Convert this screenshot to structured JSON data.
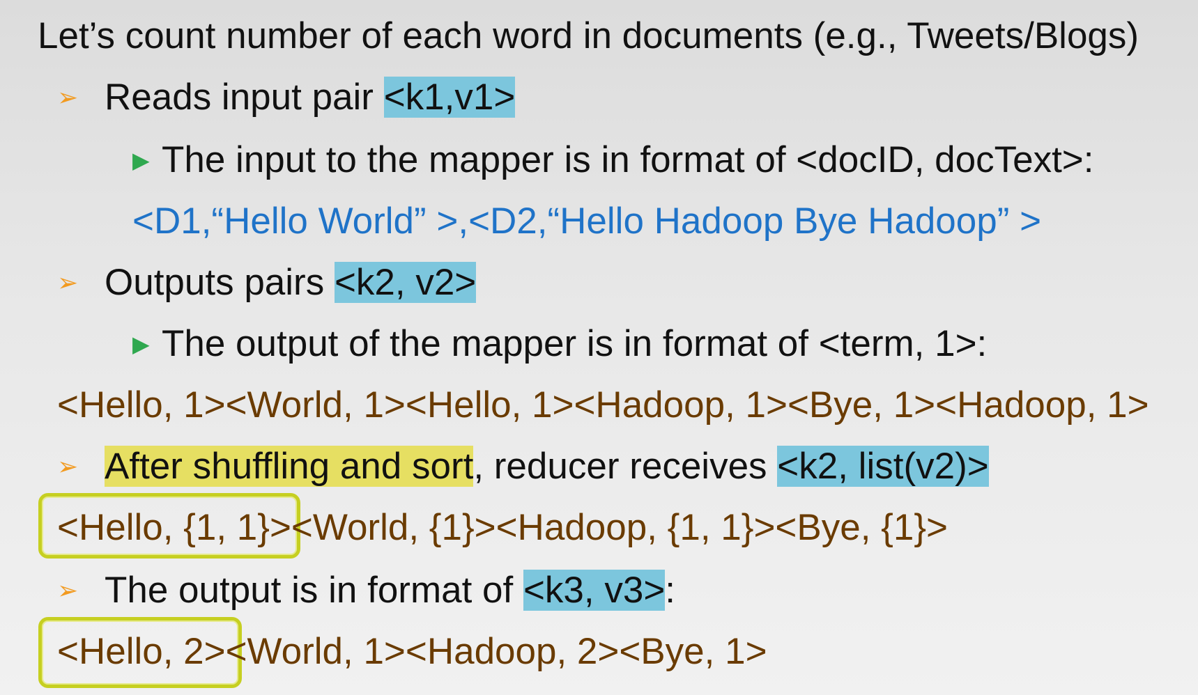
{
  "slide": {
    "title": "Let’s count number of each word in documents (e.g., Tweets/Blogs)",
    "bullet1": {
      "lead": "Reads input pair ",
      "tag": "<k1,v1>"
    },
    "sub1": "The input to the mapper is in format of <docID, docText>:",
    "input_example": "<D1,“Hello World” >,<D2,“Hello Hadoop Bye Hadoop” >",
    "bullet2": {
      "lead": "Outputs pairs ",
      "tag": "<k2, v2>"
    },
    "sub2": "The output of the mapper is in format of <term, 1>:",
    "mapper_output": "<Hello, 1><World, 1><Hello, 1><Hadoop, 1><Bye, 1><Hadoop, 1>",
    "bullet3": {
      "highlight": "After shuffling and sort",
      "middle": ", reducer receives ",
      "tag": "<k2, list(v2)>"
    },
    "reducer_input": "<Hello, {1, 1}><World, {1}><Hadoop, {1, 1}><Bye, {1}>",
    "bullet4": {
      "lead": "The output is in format of ",
      "tag": "<k3, v3>",
      "tail": ":"
    },
    "final_output": "<Hello, 2><World, 1><Hadoop, 2><Bye, 1>"
  },
  "colors": {
    "orange_bullet": "#f29a1f",
    "green_bullet": "#2fa84f",
    "blue_highlight": "#7cc6dd",
    "yellow_highlight": "#e6df62",
    "blue_text": "#1f73c8",
    "brown_text": "#6a3b00",
    "box_outline": "#c6cf21"
  },
  "icons": {
    "bullet_main": "orange-arrowhead-icon",
    "bullet_sub": "green-triangle-icon"
  }
}
